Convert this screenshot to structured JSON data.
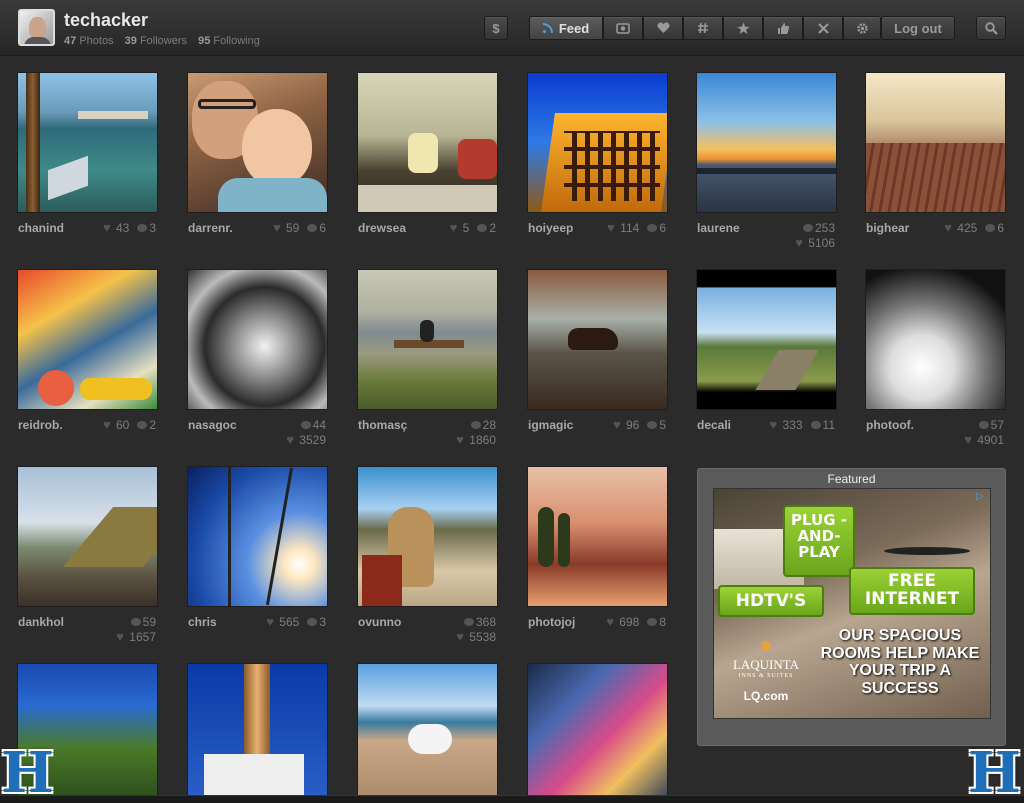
{
  "header": {
    "username": "techacker",
    "stats": [
      {
        "count": "47",
        "label": "Photos"
      },
      {
        "count": "39",
        "label": "Followers"
      },
      {
        "count": "95",
        "label": "Following"
      }
    ],
    "nav": {
      "dollar_label": "$",
      "feed_label": "Feed",
      "logout_label": "Log out"
    }
  },
  "photos": [
    {
      "user": "chanind",
      "likes": "43",
      "comments": "3"
    },
    {
      "user": "darrenr.",
      "likes": "59",
      "comments": "6"
    },
    {
      "user": "drewsea",
      "likes": "5",
      "comments": "2"
    },
    {
      "user": "hoiyeep",
      "likes": "114",
      "comments": "6"
    },
    {
      "user": "laurene",
      "likes": "5106",
      "comments": "253"
    },
    {
      "user": "bighear",
      "likes": "425",
      "comments": "6"
    },
    {
      "user": "reidrob.",
      "likes": "60",
      "comments": "2"
    },
    {
      "user": "nasagoc",
      "likes": "3529",
      "comments": "44"
    },
    {
      "user": "thomasç",
      "likes": "1860",
      "comments": "28"
    },
    {
      "user": "igmagic",
      "likes": "96",
      "comments": "5"
    },
    {
      "user": "decali",
      "likes": "333",
      "comments": "11"
    },
    {
      "user": "photoof.",
      "likes": "4901",
      "comments": "57"
    },
    {
      "user": "dankhol",
      "likes": "1657",
      "comments": "59"
    },
    {
      "user": "chris",
      "likes": "565",
      "comments": "3"
    },
    {
      "user": "ovunno",
      "likes": "5538",
      "comments": "368"
    },
    {
      "user": "photojoj",
      "likes": "698",
      "comments": "8"
    }
  ],
  "featured": {
    "title": "Featured",
    "ad": {
      "bubble1": "PLUG -AND- PLAY",
      "bubble2": "FREE INTERNET",
      "bubble3": "HDTV'S",
      "brand": "LAQUINTA",
      "brand_sub": "INNS & SUITES",
      "url": "LQ.com",
      "tagline": "OUR SPACIOUS ROOMS HELP MAKE YOUR TRIP A SUCCESS"
    }
  },
  "logos": {
    "left": "H",
    "right": "H"
  }
}
